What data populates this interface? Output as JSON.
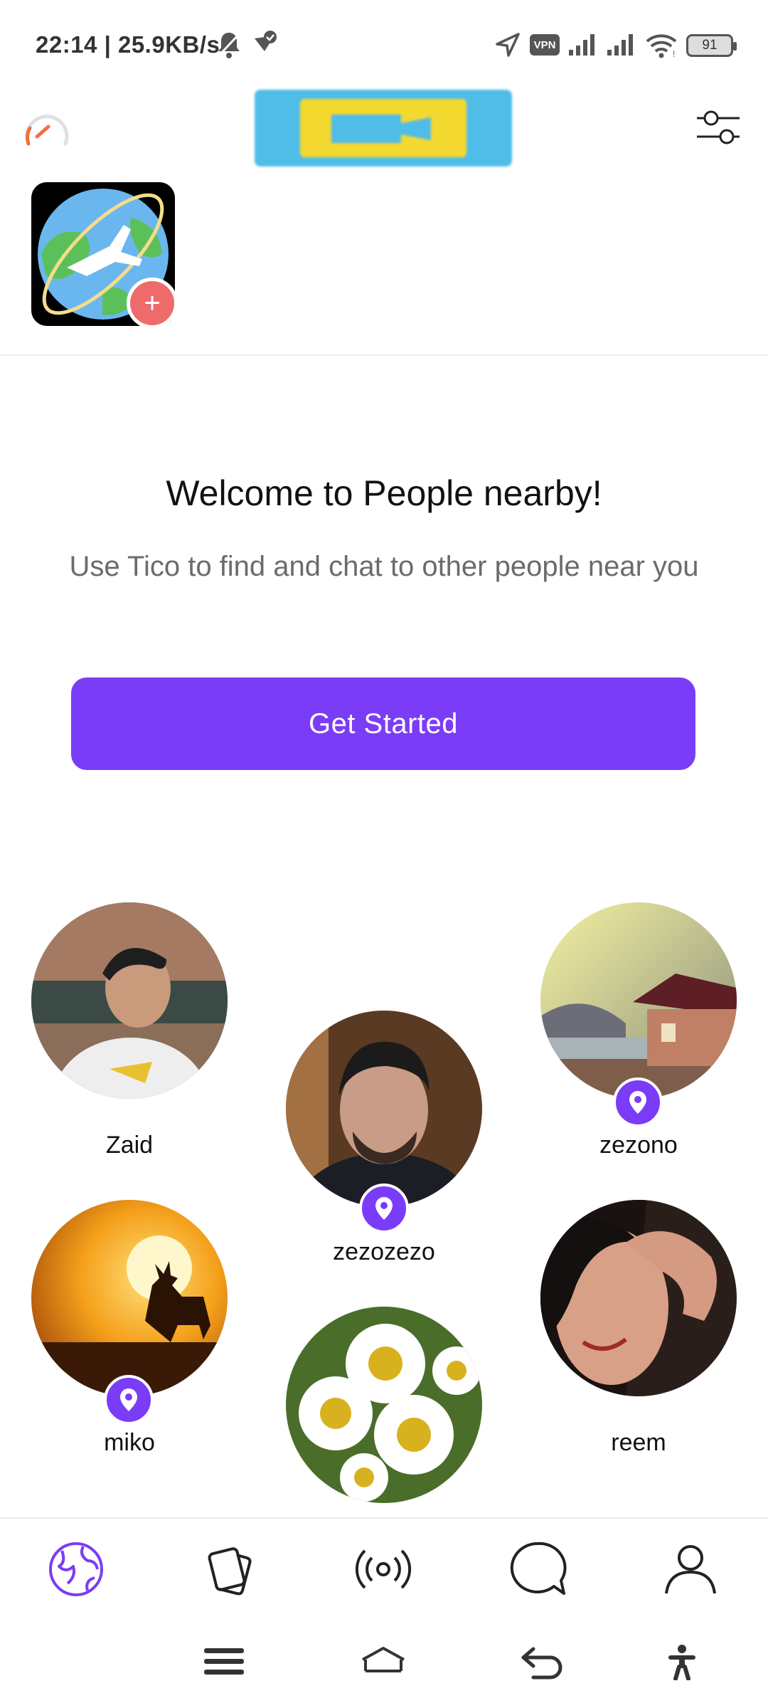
{
  "status_bar": {
    "time": "22:14 | 25.9KB/s",
    "vpn_label": "VPN",
    "battery": "91",
    "icons": [
      "alarm-off-icon",
      "check-shield-icon",
      "location-arrow-icon",
      "signal-icon",
      "signal-icon",
      "wifi-icon",
      "battery-icon"
    ]
  },
  "header": {
    "left_icon": "speedometer-icon",
    "right_icon": "filter-sliders-icon",
    "story_add_label": "+"
  },
  "welcome": {
    "title": "Welcome to People nearby!",
    "subtitle": "Use Tico to find and chat to other people near you",
    "button_label": "Get Started"
  },
  "people": [
    {
      "name": "Zaid",
      "has_location_pin": false
    },
    {
      "name": "zezozezo",
      "has_location_pin": true
    },
    {
      "name": "zezono",
      "has_location_pin": true
    },
    {
      "name": "miko",
      "has_location_pin": true
    },
    {
      "name": "",
      "has_location_pin": false
    },
    {
      "name": "reem",
      "has_location_pin": false
    }
  ],
  "bottom_nav": {
    "items": [
      "globe-icon",
      "cards-icon",
      "broadcast-icon",
      "chat-icon",
      "profile-icon"
    ],
    "active": "globe-icon",
    "accent_color": "#7b3cf7"
  },
  "system_nav": [
    "menu-icon",
    "home-icon",
    "back-icon",
    "accessibility-icon"
  ]
}
